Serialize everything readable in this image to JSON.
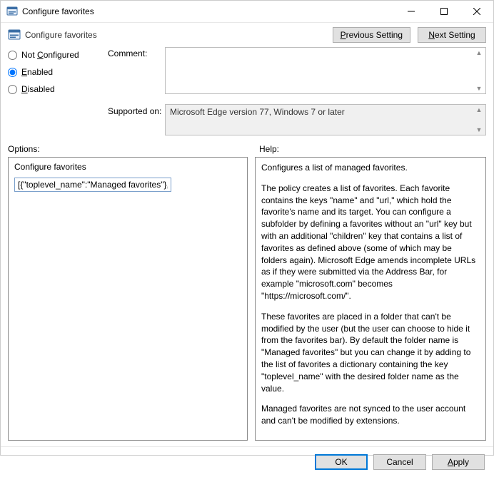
{
  "window_title": "Configure favorites",
  "header_title": "Configure favorites",
  "nav": {
    "previous": "Previous Setting",
    "next": "Next Setting"
  },
  "state": {
    "not_configured": "Not Configured",
    "enabled": "Enabled",
    "disabled": "Disabled",
    "selected": "enabled"
  },
  "labels": {
    "comment": "Comment:",
    "supported_on": "Supported on:",
    "options": "Options:",
    "help": "Help:"
  },
  "supported_on_text": "Microsoft Edge version 77, Windows 7 or later",
  "options_panel": {
    "title": "Configure favorites",
    "value": "[{\"toplevel_name\":\"Managed favorites\"},{\"n"
  },
  "help_text": {
    "p1": "Configures a list of managed favorites.",
    "p2": "The policy creates a list of favorites. Each favorite contains the keys \"name\" and \"url,\" which hold the favorite's name and its target. You can configure a subfolder by defining a favorites without an \"url\" key but with an additional \"children\" key that contains a list of favorites as defined above (some of which may be folders again). Microsoft Edge amends incomplete URLs as if they were submitted via the Address Bar, for example \"microsoft.com\" becomes \"https://microsoft.com/\".",
    "p3": "These favorites are placed in a folder that can't be modified by the user (but the user can choose to hide it from the favorites bar). By default the folder name is \"Managed favorites\" but you can change it by adding to the list of favorites a dictionary containing the key \"toplevel_name\" with the desired folder name as the value.",
    "p4": "Managed favorites are not synced to the user account and can't be modified by extensions."
  },
  "buttons": {
    "ok": "OK",
    "cancel": "Cancel",
    "apply": "Apply"
  }
}
